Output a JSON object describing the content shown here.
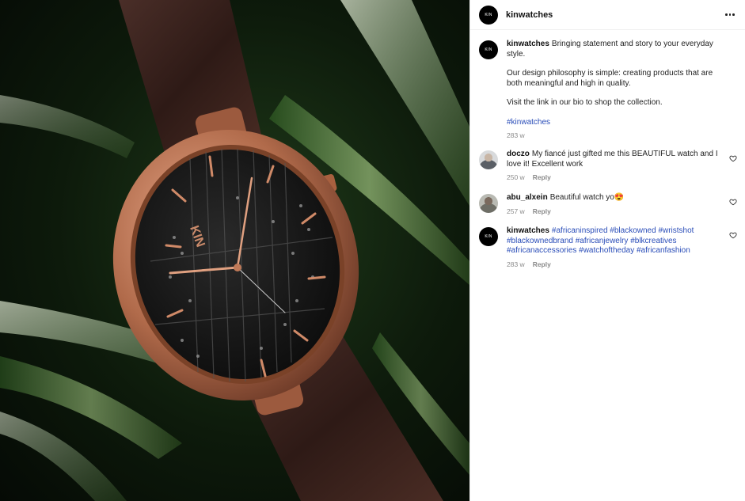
{
  "post": {
    "account": "kinwatches",
    "logo_text": "KIN",
    "caption": {
      "username": "kinwatches",
      "line1": "Bringing statement and story to your everyday style.",
      "line2": "Our design philosophy is simple: creating products that are both meaningful and high in quality.",
      "line3": "Visit the link in our bio to shop the collection.",
      "hashtag": "#kinwatches",
      "time": "283 w"
    },
    "comments": [
      {
        "username": "doczo",
        "text": "My fiancé just gifted me this BEAUTIFUL watch and I love it! Excellent work",
        "time": "250 w",
        "reply": "Reply"
      },
      {
        "username": "abu_alxein",
        "text": "Beautiful watch yo😍",
        "time": "257 w",
        "reply": "Reply"
      },
      {
        "username": "kinwatches",
        "text": "#africaninspired #blackowned #wristshot #blackownedbrand #africanjewelry #blkcreatives #africanaccessories #watchoftheday #africanfashion",
        "time": "283 w",
        "reply": "Reply"
      }
    ]
  },
  "icons": {
    "more": "more-horizontal-icon",
    "like": "heart-icon"
  },
  "colors": {
    "hashtag": "#2a4db8",
    "rose_gold": "#b8714e",
    "strap": "#3a2420"
  }
}
